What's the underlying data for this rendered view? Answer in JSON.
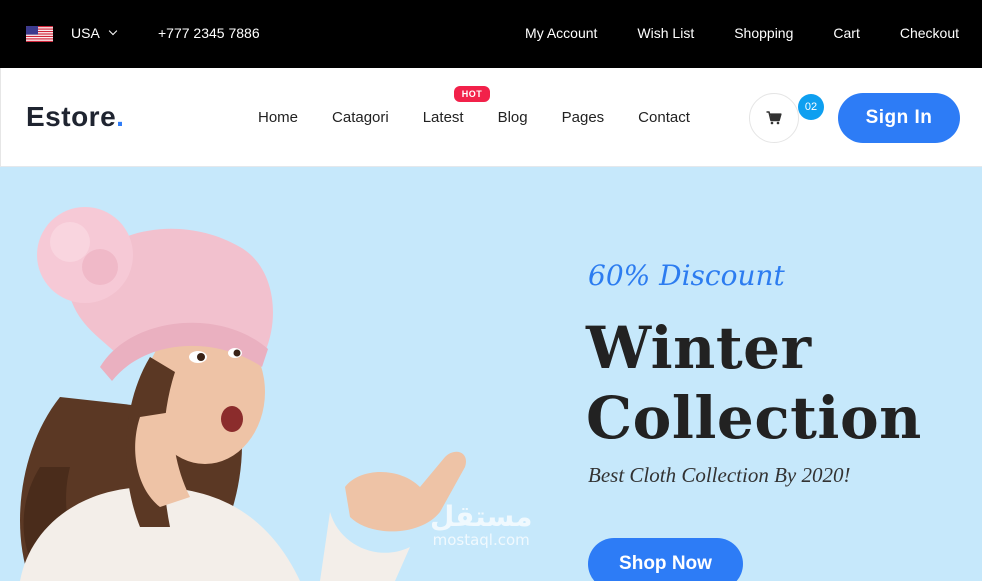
{
  "topbar": {
    "country": "USA",
    "phone": "+777 2345 7886",
    "links": [
      "My Account",
      "Wish List",
      "Shopping",
      "Cart",
      "Checkout"
    ]
  },
  "header": {
    "logo": "Estore",
    "logo_dot": ".",
    "nav": [
      "Home",
      "Catagori",
      "Latest",
      "Blog",
      "Pages",
      "Contact"
    ],
    "hot_badge": "HOT",
    "cart_count": "02",
    "signin_label": "Sign In"
  },
  "hero": {
    "discount": "60% Discount",
    "title_line1": "Winter",
    "title_line2": "Collection",
    "subtitle": "Best Cloth Collection By 2020!",
    "cta": "Shop Now",
    "watermark_arabic": "مستقل",
    "watermark_latin": "mostaql.com"
  },
  "colors": {
    "accent": "#2d7cf6",
    "hero_bg": "#c6e8fb",
    "hot": "#f2214a",
    "badge": "#0e9ff0"
  }
}
